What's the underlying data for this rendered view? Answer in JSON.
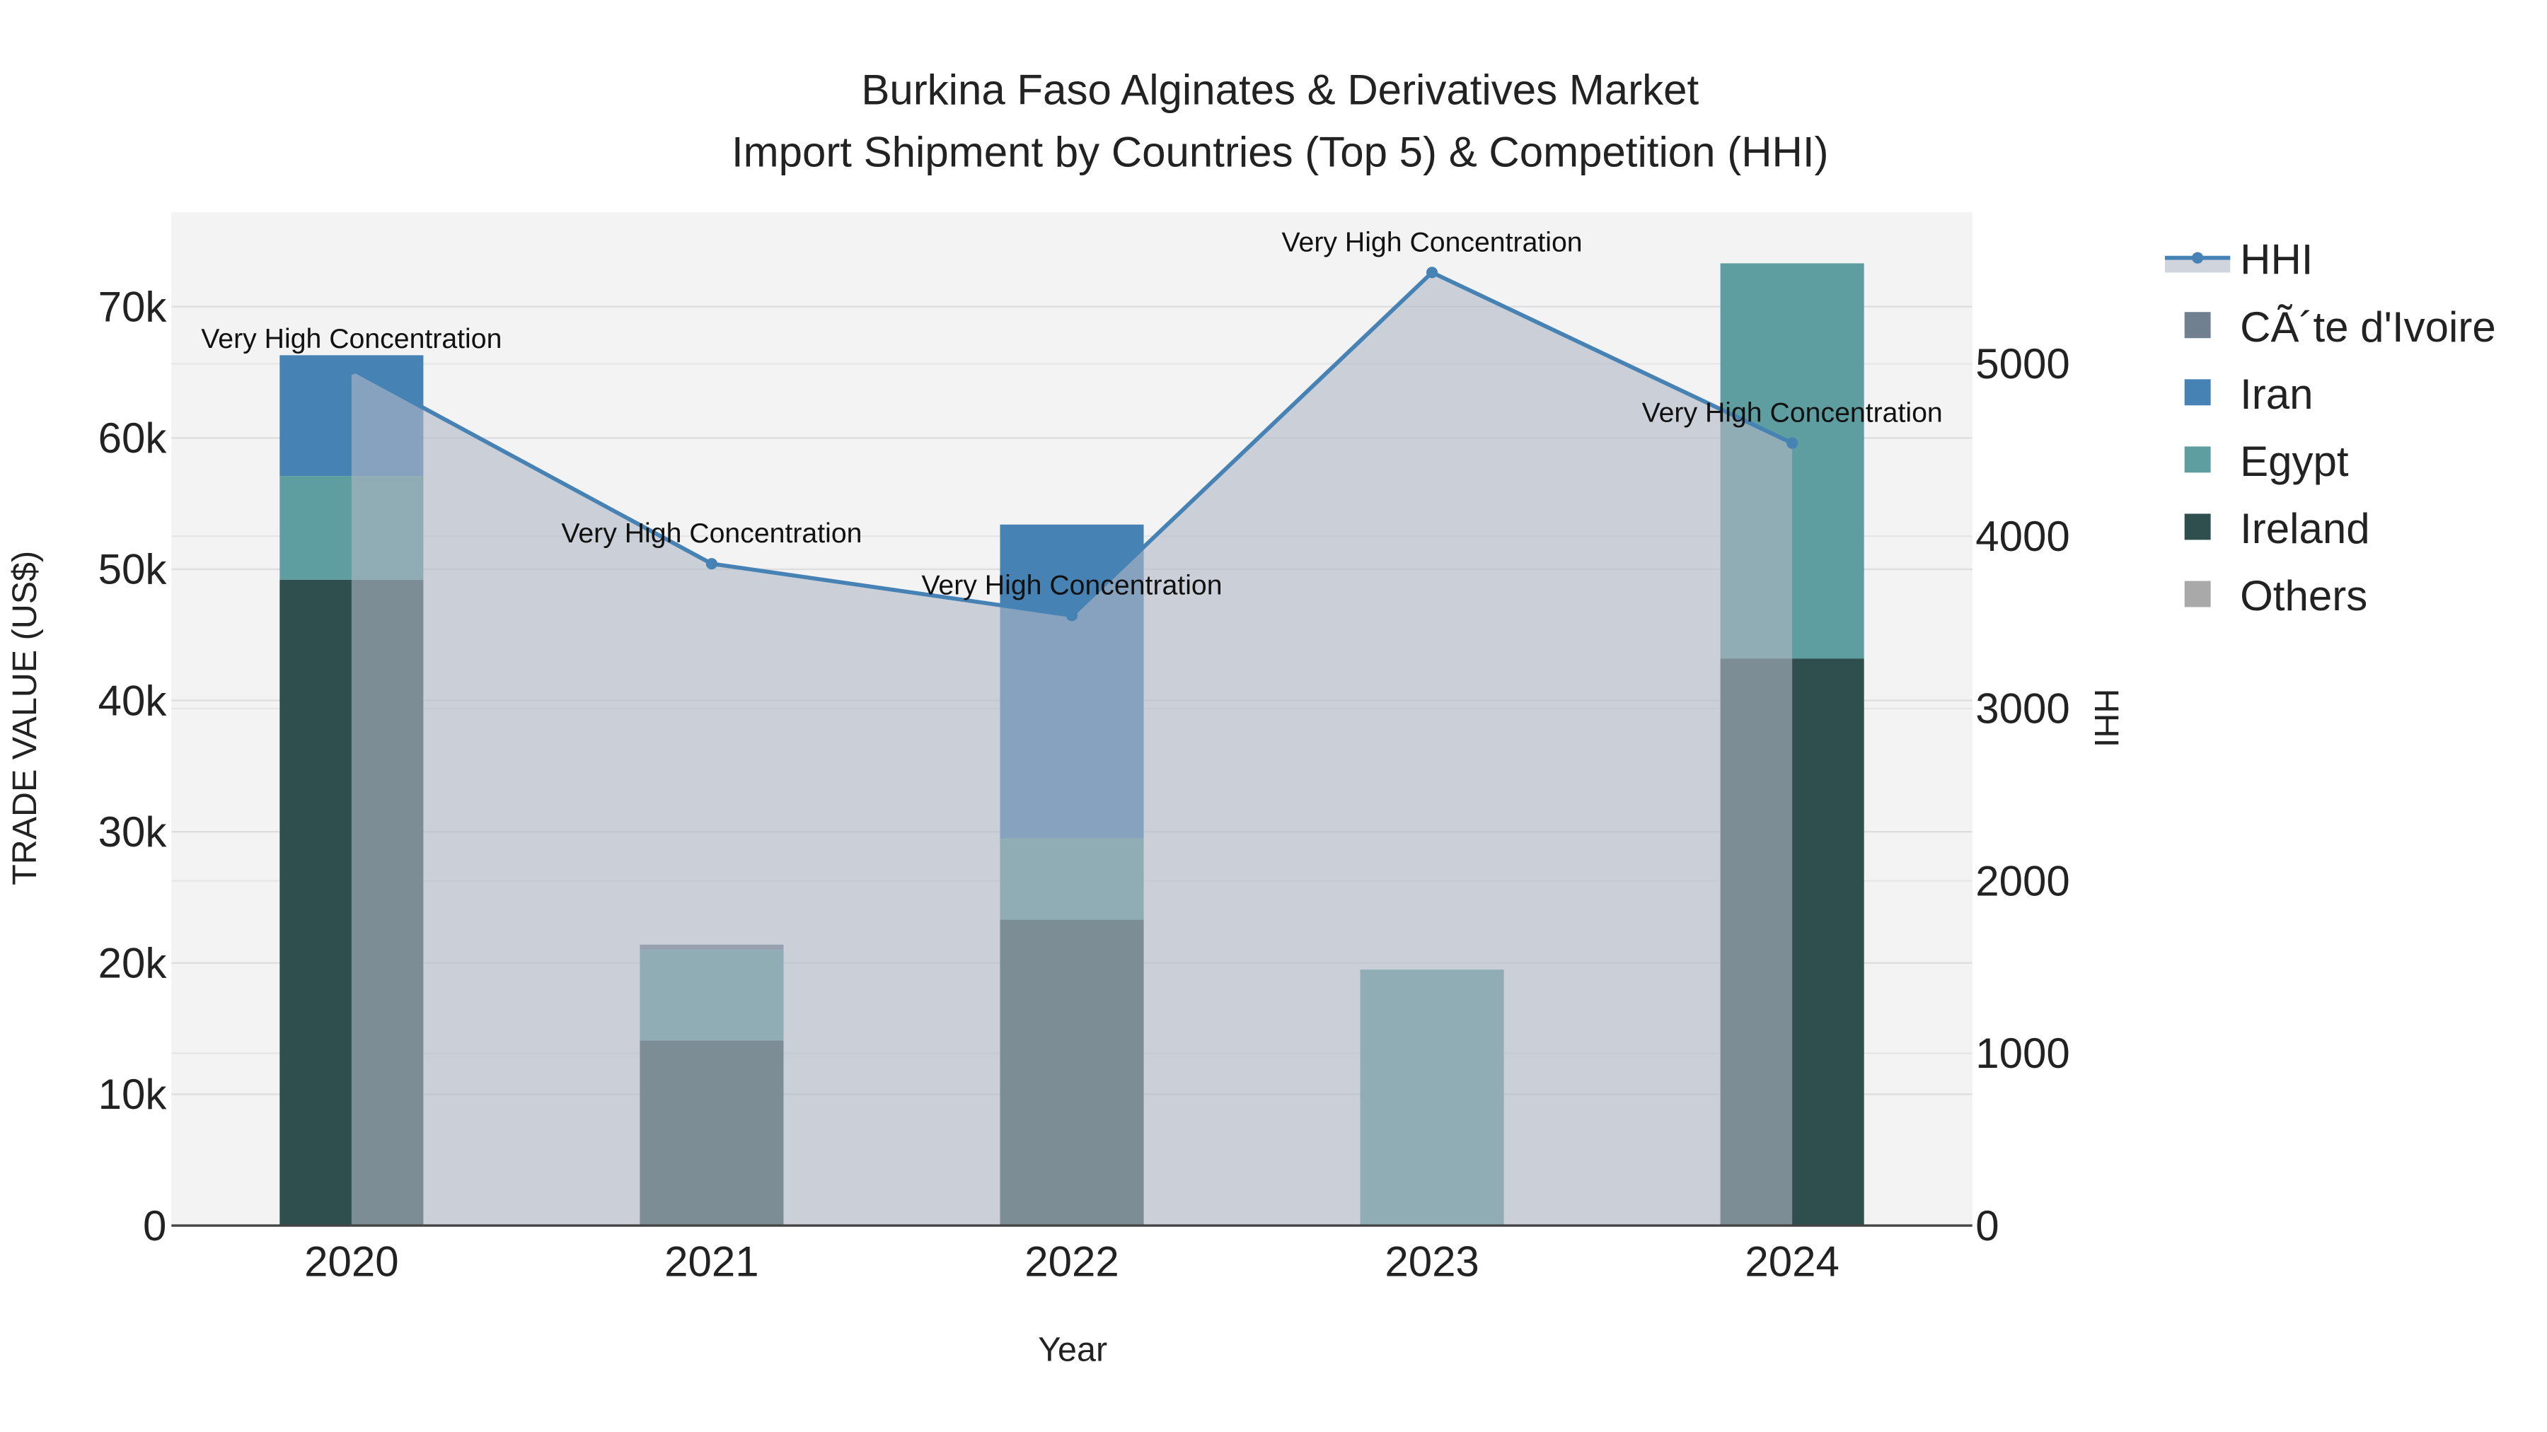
{
  "chart_data": {
    "type": "bar",
    "title_line1": "Burkina Faso Alginates & Derivatives Market",
    "title_line2": "Import Shipment by Countries (Top 5) & Competition (HHI)",
    "xlabel": "Year",
    "ylabel": "TRADE VALUE (US$)",
    "y2label": "HHI",
    "categories": [
      "2020",
      "2021",
      "2022",
      "2023",
      "2024"
    ],
    "ylim": [
      0,
      77200
    ],
    "y2lim": [
      0,
      5880
    ],
    "yticks": [
      0,
      10000,
      20000,
      30000,
      40000,
      50000,
      60000,
      70000
    ],
    "ytick_labels": [
      "0",
      "10k",
      "20k",
      "30k",
      "40k",
      "50k",
      "60k",
      "70k"
    ],
    "y2ticks": [
      0,
      1000,
      2000,
      3000,
      4000,
      5000
    ],
    "y2tick_labels": [
      "0",
      "1000",
      "2000",
      "3000",
      "4000",
      "5000"
    ],
    "stack_order": [
      "Ireland",
      "Egypt",
      "Iran",
      "CÃ´te d'Ivoire",
      "Others"
    ],
    "series": [
      {
        "name": "Ireland",
        "color": "#2f4f4f",
        "values": [
          49200,
          14100,
          23300,
          0,
          43200
        ]
      },
      {
        "name": "Egypt",
        "color": "#5f9ea0",
        "values": [
          7900,
          6900,
          6200,
          19500,
          30100
        ]
      },
      {
        "name": "Iran",
        "color": "#4682b4",
        "values": [
          9200,
          0,
          23900,
          0,
          0
        ]
      },
      {
        "name": "CÃ´te d'Ivoire",
        "color": "#708090",
        "values": [
          0,
          400,
          0,
          0,
          0
        ]
      },
      {
        "name": "Others",
        "color": "#a9a9a9",
        "values": [
          0,
          0,
          0,
          0,
          0
        ]
      }
    ],
    "hhi": {
      "name": "HHI",
      "color": "#4682b4",
      "fill": "rgba(176,184,196,0.6)",
      "values": [
        4970,
        3840,
        3540,
        5530,
        4540
      ],
      "annotations": [
        "Very High Concentration",
        "Very High Concentration",
        "Very High Concentration",
        "Very High Concentration",
        "Very High Concentration"
      ]
    },
    "legend": [
      "HHI",
      "CÃ´te d'Ivoire",
      "Iran",
      "Egypt",
      "Ireland",
      "Others"
    ],
    "legend_placement": "right",
    "grid": true
  }
}
